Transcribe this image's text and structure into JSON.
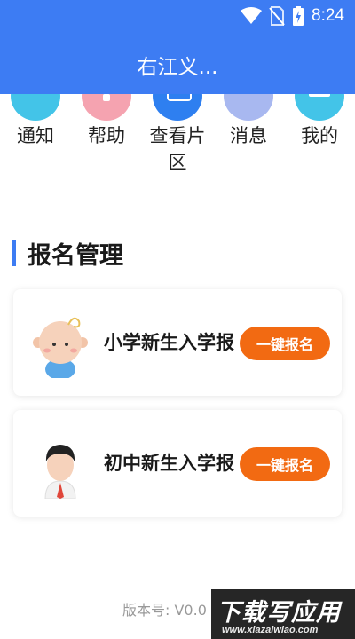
{
  "status_bar": {
    "time": "8:24",
    "icons": [
      "wifi-icon",
      "no-sim-icon",
      "battery-charging-icon"
    ]
  },
  "header": {
    "title": "右江义..."
  },
  "nav": {
    "items": [
      {
        "label": "通知",
        "icon": "notice-icon",
        "color": "#43c4e8"
      },
      {
        "label": "帮助",
        "icon": "help-icon",
        "color": "#f5a3b0"
      },
      {
        "label": "查看片区",
        "icon": "area-icon",
        "color": "#2e7ff0"
      },
      {
        "label": "消息",
        "icon": "message-icon",
        "color": "#a8b8f0"
      },
      {
        "label": "我的",
        "icon": "profile-icon",
        "color": "#43c4e8"
      }
    ]
  },
  "section": {
    "title": "报名管理",
    "accent_color": "#3d7cf3"
  },
  "cards": [
    {
      "title": "小学新生入学报",
      "button": "一键报名",
      "avatar": "baby-avatar-icon"
    },
    {
      "title": "初中新生入学报",
      "button": "一键报名",
      "avatar": "boy-avatar-icon"
    }
  ],
  "footer": {
    "version": "版本号: V0.0"
  },
  "watermark": {
    "text": "下载写应用",
    "url": "www.xiazaiwiao.com"
  },
  "colors": {
    "primary": "#3d7cf3",
    "button": "#f26a12"
  }
}
